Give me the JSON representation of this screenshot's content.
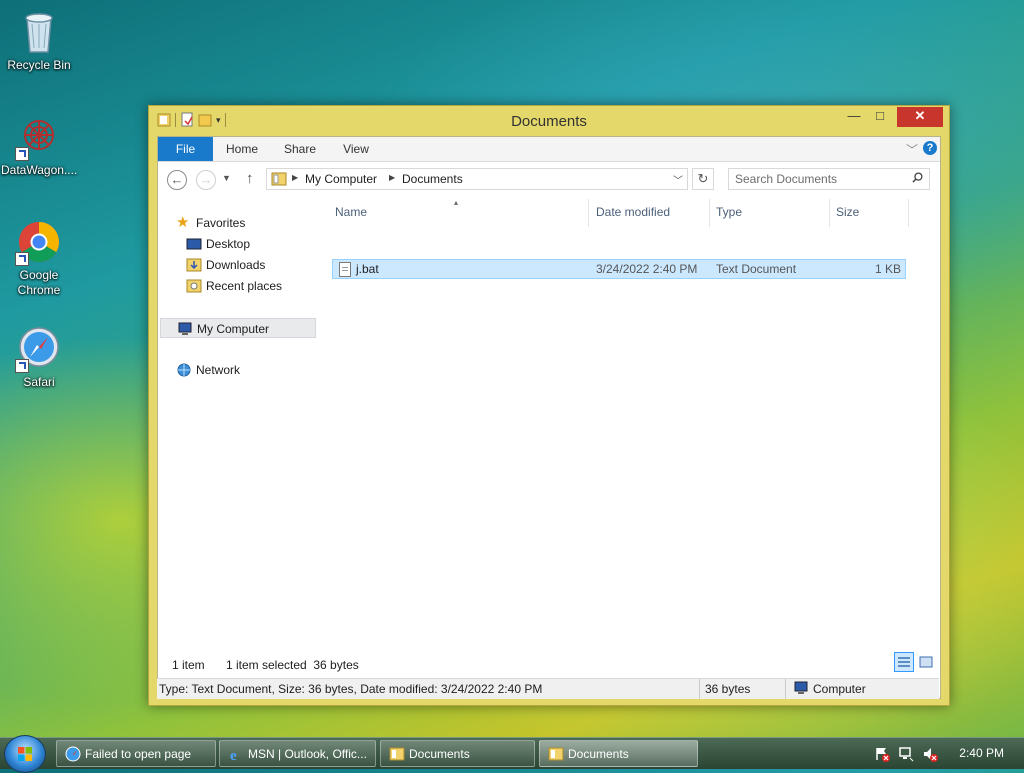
{
  "desktop": {
    "icons": [
      {
        "label": "Recycle Bin",
        "icon": "recycle-bin-icon"
      },
      {
        "label": "DataWagon....",
        "icon": "datawagon-icon"
      },
      {
        "label": "Google Chrome",
        "icon": "chrome-icon"
      },
      {
        "label": "Safari",
        "icon": "safari-icon"
      }
    ]
  },
  "window": {
    "title": "Documents",
    "controls": {
      "minimize": "—",
      "maximize": "□",
      "close": "✕"
    },
    "ribbon": {
      "tabs": [
        "File",
        "Home",
        "Share",
        "View"
      ],
      "active_tab": "File",
      "accent": "#1979ca"
    },
    "address": {
      "crumbs": [
        "My Computer",
        "Documents"
      ]
    },
    "search": {
      "placeholder": "Search Documents"
    },
    "nav_pane": {
      "favorites_label": "Favorites",
      "favorites": [
        "Desktop",
        "Downloads",
        "Recent places"
      ],
      "computer_label": "My Computer",
      "network_label": "Network"
    },
    "columns": [
      "Name",
      "Date modified",
      "Type",
      "Size"
    ],
    "files": [
      {
        "name": "j.bat",
        "date_modified": "3/24/2022 2:40 PM",
        "type": "Text Document",
        "size": "1 KB",
        "selected": true
      }
    ],
    "status": {
      "item_count": "1 item",
      "selection": "1 item selected  36 bytes"
    },
    "details_bar": {
      "description": "Type: Text Document, Size: 36 bytes, Date modified: 3/24/2022 2:40 PM",
      "size": "36 bytes",
      "location": "Computer"
    },
    "frame_color": "#e4d86a"
  },
  "taskbar": {
    "tasks": [
      {
        "label": "Failed to open page",
        "icon": "browser-icon"
      },
      {
        "label": "MSN | Outlook, Offic...",
        "icon": "ie-icon"
      },
      {
        "label": "Documents",
        "icon": "folder-icon"
      },
      {
        "label": "Documents",
        "icon": "folder-icon",
        "active": true
      }
    ],
    "tray": [
      "action-center-icon",
      "network-icon",
      "volume-muted-icon"
    ],
    "clock": "2:40 PM"
  }
}
